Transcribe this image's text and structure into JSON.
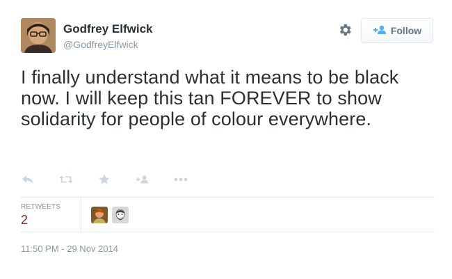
{
  "user": {
    "name": "Godfrey Elfwick",
    "handle": "@GodfreyElfwick"
  },
  "follow_button": {
    "label": "Follow"
  },
  "tweet": {
    "text": "I finally understand what it means to be black now. I will keep this tan FOREVER to show solidarity for people of colour everywhere."
  },
  "actions": [
    {
      "name": "reply-icon"
    },
    {
      "name": "retweet-icon"
    },
    {
      "name": "favorite-icon"
    },
    {
      "name": "follow-user-icon"
    },
    {
      "name": "more-icon"
    }
  ],
  "stats": {
    "retweets_label": "RETWEETS",
    "retweets_count": "2"
  },
  "timestamp": "11:50 PM - 29 Nov 2014",
  "colors": {
    "text": "#292f33",
    "muted": "#8899a6",
    "accent": "#55acee",
    "border": "#e1e8ed",
    "count": "#8a2b1a"
  }
}
